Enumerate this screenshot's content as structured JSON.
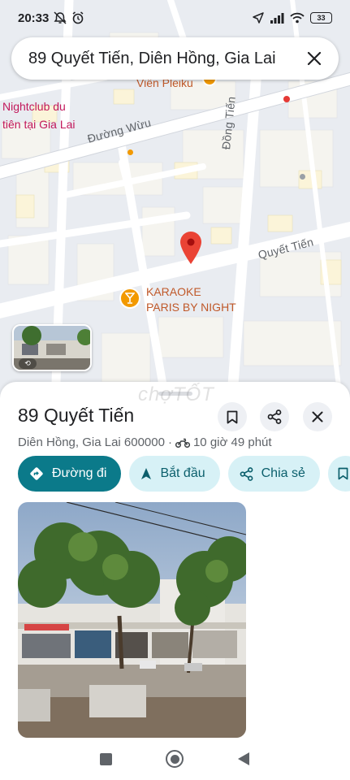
{
  "status_bar": {
    "time": "20:33",
    "battery": "33",
    "icons": [
      "alarm-off-icon",
      "alarm-clock-icon",
      "location-arrow-icon",
      "signal-icon",
      "wifi-icon",
      "battery-icon"
    ]
  },
  "search": {
    "query": "89 Quyết Tiến, Diên Hồng, Gia Lai"
  },
  "map": {
    "labels": {
      "vien_pleiku": "Viên Pleiku",
      "nightclub_1": "Nightclub du",
      "nightclub_2": "tiên tại Gia Lai",
      "duong_wuu": "Đường Wừu",
      "dong_tien": "Đồng Tiến",
      "quyet_tien": "Quyết Tiến",
      "karaoke_1": "KARAOKE",
      "karaoke_2": "PARIS BY NIGHT"
    },
    "colors": {
      "pin": "#ea4335",
      "poi": "#f29900",
      "road": "#ffffff",
      "block": "#f4f4f1"
    }
  },
  "watermark": "chợTỐT",
  "place": {
    "title": "89 Quyết Tiến",
    "address": "Diên Hồng, Gia Lai 600000",
    "separator": "·",
    "travel_time": "10 giờ 49 phút",
    "travel_mode_icon": "motorbike-icon"
  },
  "actions": {
    "directions": "Đường đi",
    "start": "Bắt đầu",
    "share": "Chia sẻ"
  },
  "theme": {
    "primary": "#0b7a8a",
    "secondary_bg": "#d7f1f6",
    "secondary_text": "#0b5f6c"
  },
  "nav": {
    "icons": [
      "recents-square-icon",
      "home-circle-icon",
      "back-triangle-icon"
    ]
  }
}
